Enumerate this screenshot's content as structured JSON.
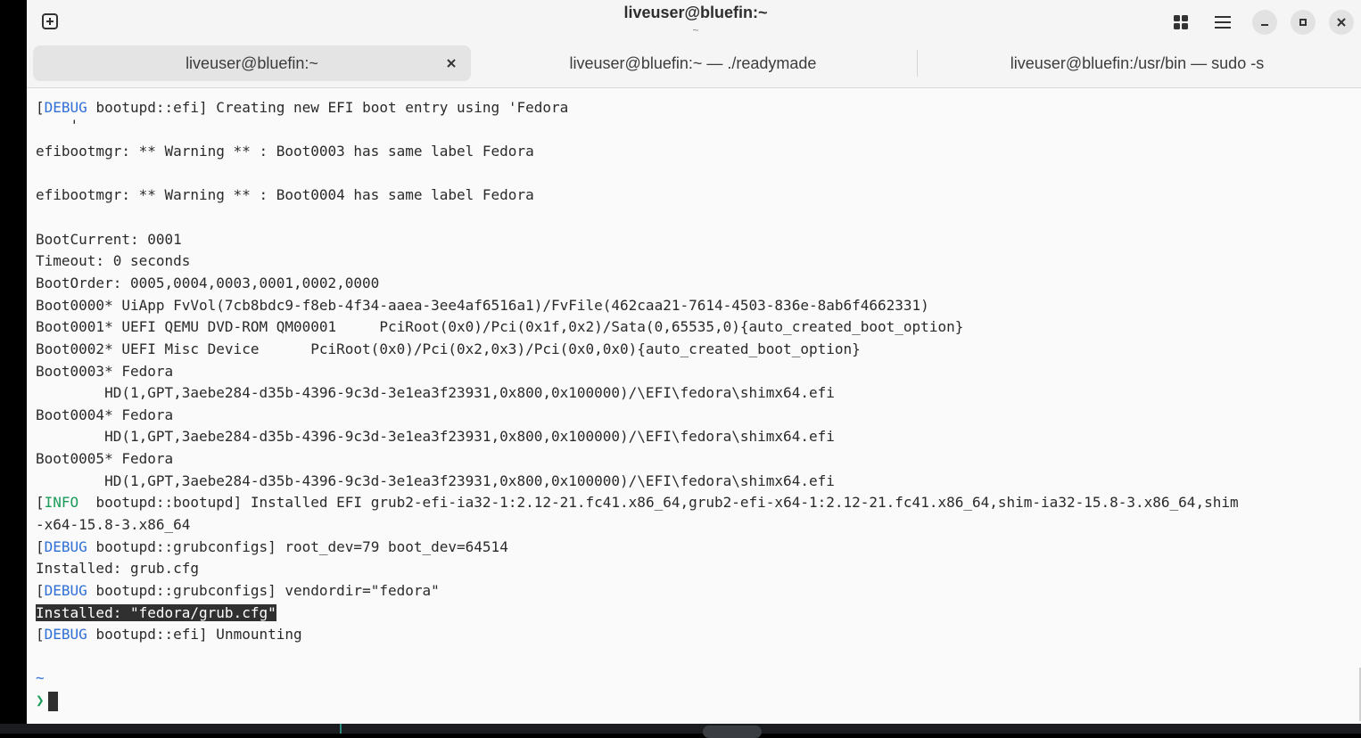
{
  "window": {
    "title": "liveuser@bluefin:~",
    "subtitle": "~"
  },
  "icons": {
    "new_tab": "plus-square-icon",
    "grid": "grid-icon",
    "menu": "hamburger-menu-icon",
    "minimize": "minimize-icon",
    "maximize": "maximize-icon",
    "close": "close-icon",
    "tab_close": "close-icon"
  },
  "tabs": [
    {
      "label": "liveuser@bluefin:~",
      "active": true
    },
    {
      "label": "liveuser@bluefin:~ — ./readymade",
      "active": false
    },
    {
      "label": "liveuser@bluefin:/usr/bin — sudo -s",
      "active": false
    }
  ],
  "terminal": {
    "l1_open": "[",
    "l1_tag": "DEBUG",
    "l1_rest": " bootupd::efi] Creating new EFI boot entry using 'Fedora",
    "l1b": "    '",
    "l2": "efibootmgr: ** Warning ** : Boot0003 has same label Fedora",
    "l3": "efibootmgr: ** Warning ** : Boot0004 has same label Fedora",
    "l4": "BootCurrent: 0001",
    "l5": "Timeout: 0 seconds",
    "l6": "BootOrder: 0005,0004,0003,0001,0002,0000",
    "l7": "Boot0000* UiApp FvVol(7cb8bdc9-f8eb-4f34-aaea-3ee4af6516a1)/FvFile(462caa21-7614-4503-836e-8ab6f4662331)",
    "l8": "Boot0001* UEFI QEMU DVD-ROM QM00001     PciRoot(0x0)/Pci(0x1f,0x2)/Sata(0,65535,0){auto_created_boot_option}",
    "l9": "Boot0002* UEFI Misc Device      PciRoot(0x0)/Pci(0x2,0x3)/Pci(0x0,0x0){auto_created_boot_option}",
    "l10": "Boot0003* Fedora",
    "l11": "        HD(1,GPT,3aebe284-d35b-4396-9c3d-3e1ea3f23931,0x800,0x100000)/\\EFI\\fedora\\shimx64.efi",
    "l12": "Boot0004* Fedora",
    "l13": "        HD(1,GPT,3aebe284-d35b-4396-9c3d-3e1ea3f23931,0x800,0x100000)/\\EFI\\fedora\\shimx64.efi",
    "l14": "Boot0005* Fedora",
    "l15": "        HD(1,GPT,3aebe284-d35b-4396-9c3d-3e1ea3f23931,0x800,0x100000)/\\EFI\\fedora\\shimx64.efi",
    "l16_open": "[",
    "l16_tag": "INFO",
    "l16_rest": "  bootupd::bootupd] Installed EFI grub2-efi-ia32-1:2.12-21.fc41.x86_64,grub2-efi-x64-1:2.12-21.fc41.x86_64,shim-ia32-15.8-3.x86_64,shim",
    "l16b": "-x64-15.8-3.x86_64",
    "l17_open": "[",
    "l17_tag": "DEBUG",
    "l17_rest": " bootupd::grubconfigs] root_dev=79 boot_dev=64514",
    "l18": "Installed: grub.cfg",
    "l19_open": "[",
    "l19_tag": "DEBUG",
    "l19_rest": " bootupd::grubconfigs] vendordir=\"fedora\"",
    "l20": "Installed: \"fedora/grub.cfg\"",
    "l21_open": "[",
    "l21_tag": "DEBUG",
    "l21_rest": " bootupd::efi] Unmounting",
    "prompt_dir": "~",
    "prompt_symbol": "❯"
  },
  "colors": {
    "debug_tag": "#2f6fd6",
    "info_tag": "#1a9c5a",
    "selection_bg": "#303030"
  }
}
